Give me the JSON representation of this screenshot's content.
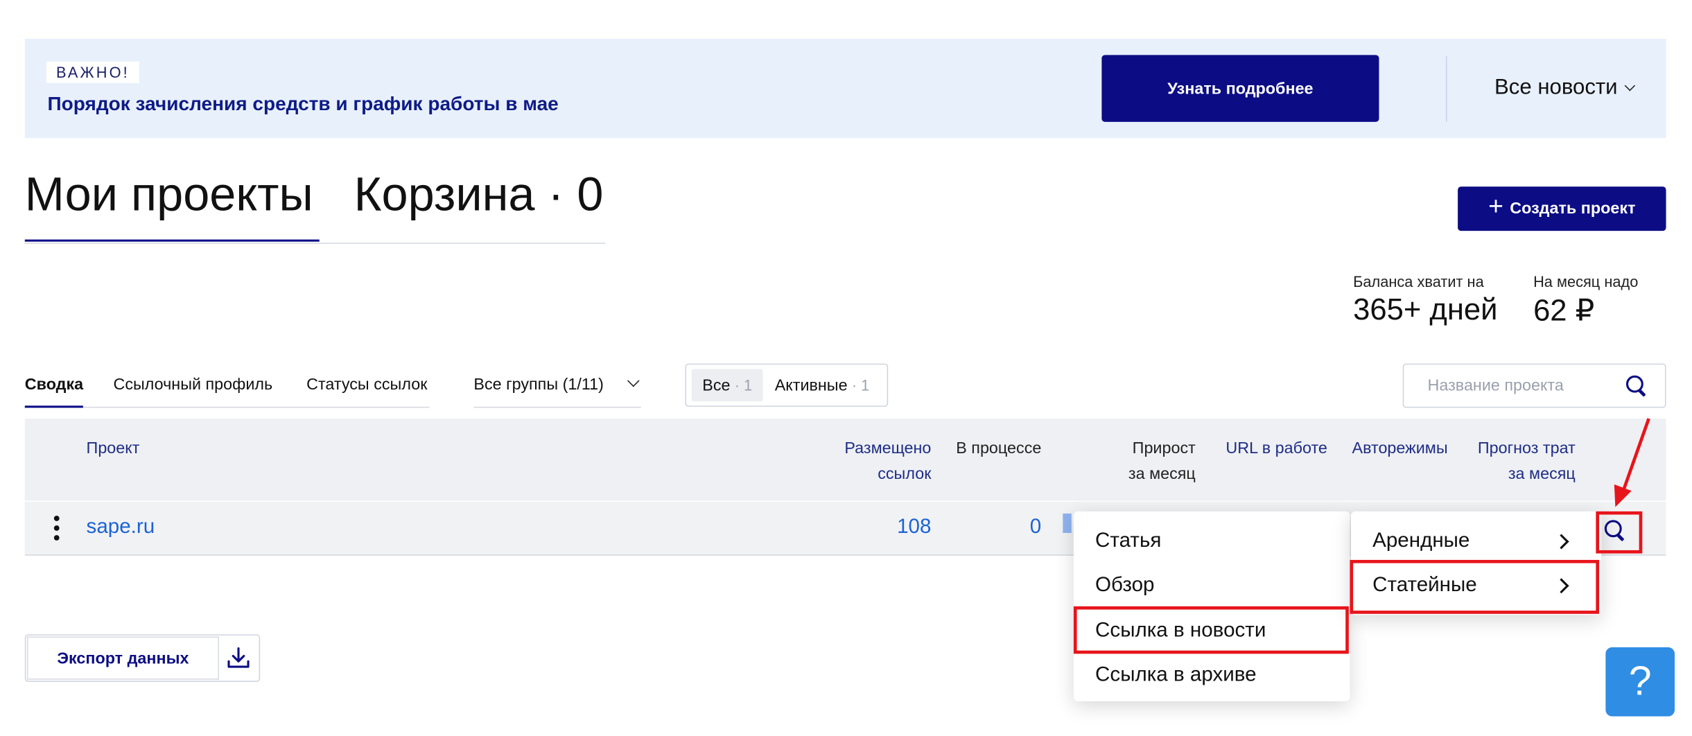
{
  "banner": {
    "tag": "ВАЖНО!",
    "title": "Порядок зачисления средств и график работы в мае",
    "more_button": "Узнать подробнее",
    "news_dropdown": "Все новости"
  },
  "page_tabs": {
    "my_projects": "Мои проекты",
    "cart": "Корзина · 0"
  },
  "create_button": "Создать проект",
  "stats": {
    "balance_label": "Баланса хватит на",
    "balance_value": "365+ дней",
    "month_label": "На месяц надо",
    "month_value": "62 ₽"
  },
  "sub_tabs": [
    "Сводка",
    "Ссылочный профиль",
    "Статусы ссылок"
  ],
  "groups_dropdown": "Все группы (1/11)",
  "segment": {
    "all_label": "Все",
    "all_count": "· 1",
    "active_label": "Активные",
    "active_count": "· 1"
  },
  "search": {
    "placeholder": "Название проекта"
  },
  "table": {
    "headers": {
      "project": "Проект",
      "placed_1": "Размещено",
      "placed_2": "ссылок",
      "in_progress": "В процессе",
      "growth_1": "Прирост",
      "growth_2": "за месяц",
      "url": "URL в работе",
      "auto": "Авторежимы",
      "forecast_1": "Прогноз трат",
      "forecast_2": "за месяц"
    },
    "rows": [
      {
        "project": "sape.ru",
        "placed": "108",
        "in_progress": "0"
      }
    ]
  },
  "export_button": "Экспорт данных",
  "menu_main": [
    "Статья",
    "Обзор",
    "Ссылка в новости",
    "Ссылка в архиве"
  ],
  "menu_sub": [
    "Арендные",
    "Статейные"
  ],
  "help_label": "?",
  "colors": {
    "primary": "#0c0d85",
    "link": "#1b63d6",
    "highlight": "#e8141b",
    "banner_bg": "#e8f0fb",
    "help": "#2f8de4"
  }
}
